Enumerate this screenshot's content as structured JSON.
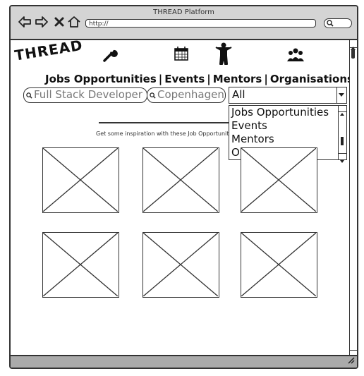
{
  "window": {
    "title": "THREAD Platform",
    "address": "http://"
  },
  "brand": {
    "logo": "THREAD"
  },
  "nav_icons": [
    "wrench-icon",
    "calendar-icon",
    "person-icon",
    "group-icon"
  ],
  "nav": {
    "jobs": "Jobs Opportunities",
    "events": "Events",
    "mentors": "Mentors",
    "organisations": "Organisations",
    "separator": "|"
  },
  "search": {
    "keyword_value": "Full Stack Developer",
    "location_value": "Copenhagen"
  },
  "category": {
    "selected": "All",
    "options": [
      "Jobs Opportunities",
      "Events",
      "Mentors",
      "Organisations"
    ]
  },
  "inspiration": {
    "text": "Get some inspiration with these Job Opportunities"
  },
  "gallery": {
    "count": 6
  }
}
